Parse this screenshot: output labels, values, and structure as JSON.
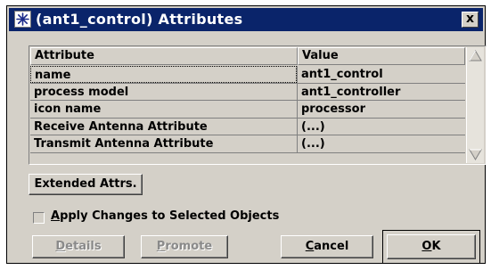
{
  "window": {
    "title": "(ant1_control) Attributes",
    "close_label": "x"
  },
  "table": {
    "columns": [
      "Attribute",
      "Value"
    ],
    "rows": [
      {
        "attribute": "name",
        "value": "ant1_control"
      },
      {
        "attribute": "process model",
        "value": "ant1_controller"
      },
      {
        "attribute": "icon name",
        "value": "processor"
      },
      {
        "attribute": "Receive Antenna Attribute",
        "value": "(...)"
      },
      {
        "attribute": "Transmit Antenna Attribute",
        "value": "(...)"
      }
    ]
  },
  "buttons": {
    "extended": "Extended Attrs.",
    "details_rest": "etails",
    "details_key": "D",
    "promote_rest": "romote",
    "promote_key": "P",
    "cancel_rest": "ancel",
    "cancel_key": "C",
    "ok_rest": "K",
    "ok_key": "O"
  },
  "checkbox": {
    "label_key": "A",
    "label_rest": "pply Changes to Selected Objects",
    "checked": false
  },
  "colors": {
    "titlebar": "#0a246a",
    "dialog_bg": "#d4d0c8"
  },
  "icons": {
    "title": "asterisk-star-icon",
    "scroll_up": "triangle-up-icon",
    "scroll_down": "triangle-down-icon"
  }
}
